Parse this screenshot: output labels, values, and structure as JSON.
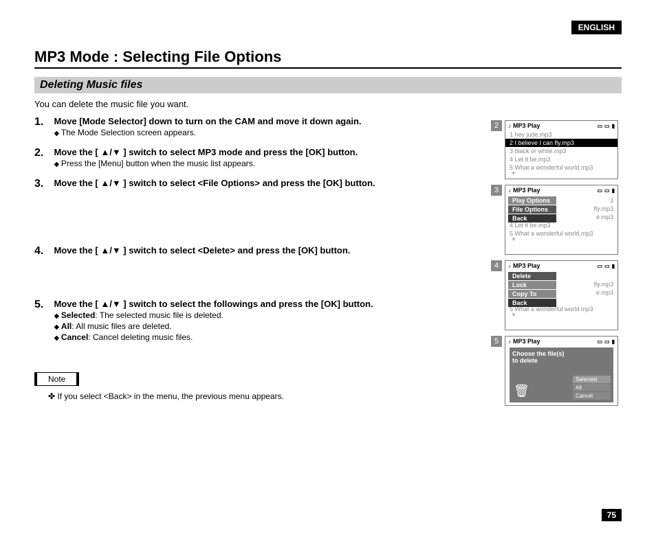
{
  "lang": "ENGLISH",
  "title": "MP3 Mode : Selecting File Options",
  "section": "Deleting Music files",
  "intro": "You can delete the music file you want.",
  "steps": [
    {
      "num": "1.",
      "main": "Move [Mode Selector] down to turn on the CAM and move it down again.",
      "subs": [
        "The Mode Selection screen appears."
      ]
    },
    {
      "num": "2.",
      "main": "Move the [ ▲/▼ ] switch to select MP3 mode and press the [OK] button.",
      "subs": [
        "Press the [Menu] button when the music list appears."
      ]
    },
    {
      "num": "3.",
      "main": "Move the [ ▲/▼ ] switch to select <File Options> and press the [OK] button.",
      "subs": []
    },
    {
      "num": "4.",
      "main": "Move the [ ▲/▼ ] switch to select <Delete> and press the [OK] button.",
      "subs": []
    },
    {
      "num": "5.",
      "main": "Move the [ ▲/▼ ] switch to select the followings and press the [OK] button.",
      "subs": []
    }
  ],
  "step5_options": [
    {
      "bold": "Selected",
      "rest": ": The selected music file is deleted."
    },
    {
      "bold": "All",
      "rest": ": All music files are deleted."
    },
    {
      "bold": "Cancel",
      "rest": ": Cancel deleting music files."
    }
  ],
  "note_label": "Note",
  "note_text": "If you select <Back> in the menu, the previous menu appears.",
  "page_num": "75",
  "screen_title": "MP3 Play",
  "tracks": [
    "1  hey jude.mp3",
    "2  I believe I can fly.mp3",
    "3  black or white.mp3",
    "4  Let it be.mp3",
    "5  What a wonderful world.mp3"
  ],
  "menu3": [
    "Play Options",
    "File Options",
    "Back"
  ],
  "menu4": [
    "Delete",
    "Lock",
    "Copy To",
    "Back"
  ],
  "dialog": {
    "prompt1": "Choose the file(s)",
    "prompt2": "to delete",
    "opts": [
      "Selected",
      "All",
      "Cancel"
    ]
  },
  "screen_nums": [
    "2",
    "3",
    "4",
    "5"
  ]
}
